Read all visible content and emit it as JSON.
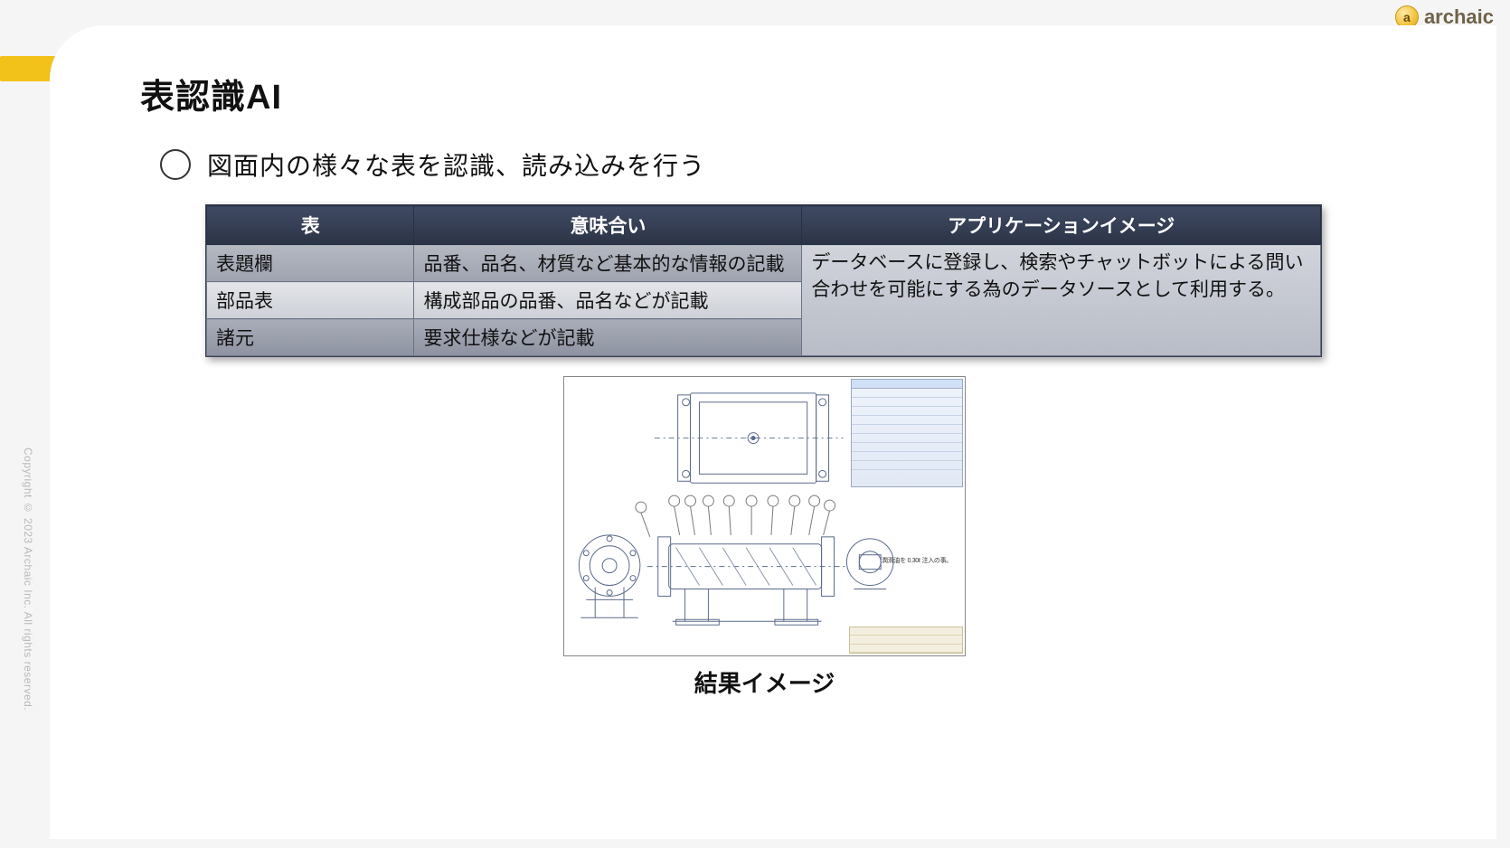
{
  "brand": {
    "name": "archaic",
    "icon_letter": "a"
  },
  "title": "表認識AI",
  "bullet": "図面内の様々な表を認識、読み込みを行う",
  "table": {
    "headers": [
      "表",
      "意味合い",
      "アプリケーションイメージ"
    ],
    "rows": [
      {
        "c0": "表題欄",
        "c1": "品番、品名、材質など基本的な情報の記載"
      },
      {
        "c0": "部品表",
        "c1": "構成部品の品番、品名などが記載"
      },
      {
        "c0": "諸元",
        "c1": "要求仕様などが記載"
      }
    ],
    "merged_c2": "データベースに登録し、検索やチャットボットによる問い合わせを可能にする為のデータソースとして利用する。"
  },
  "result": {
    "caption": "結果イメージ",
    "note": "潤滑油を 0.30ℓ 注入の事。"
  },
  "copyright": "Copyright © 2023 Archaic Inc. All rights reserved."
}
